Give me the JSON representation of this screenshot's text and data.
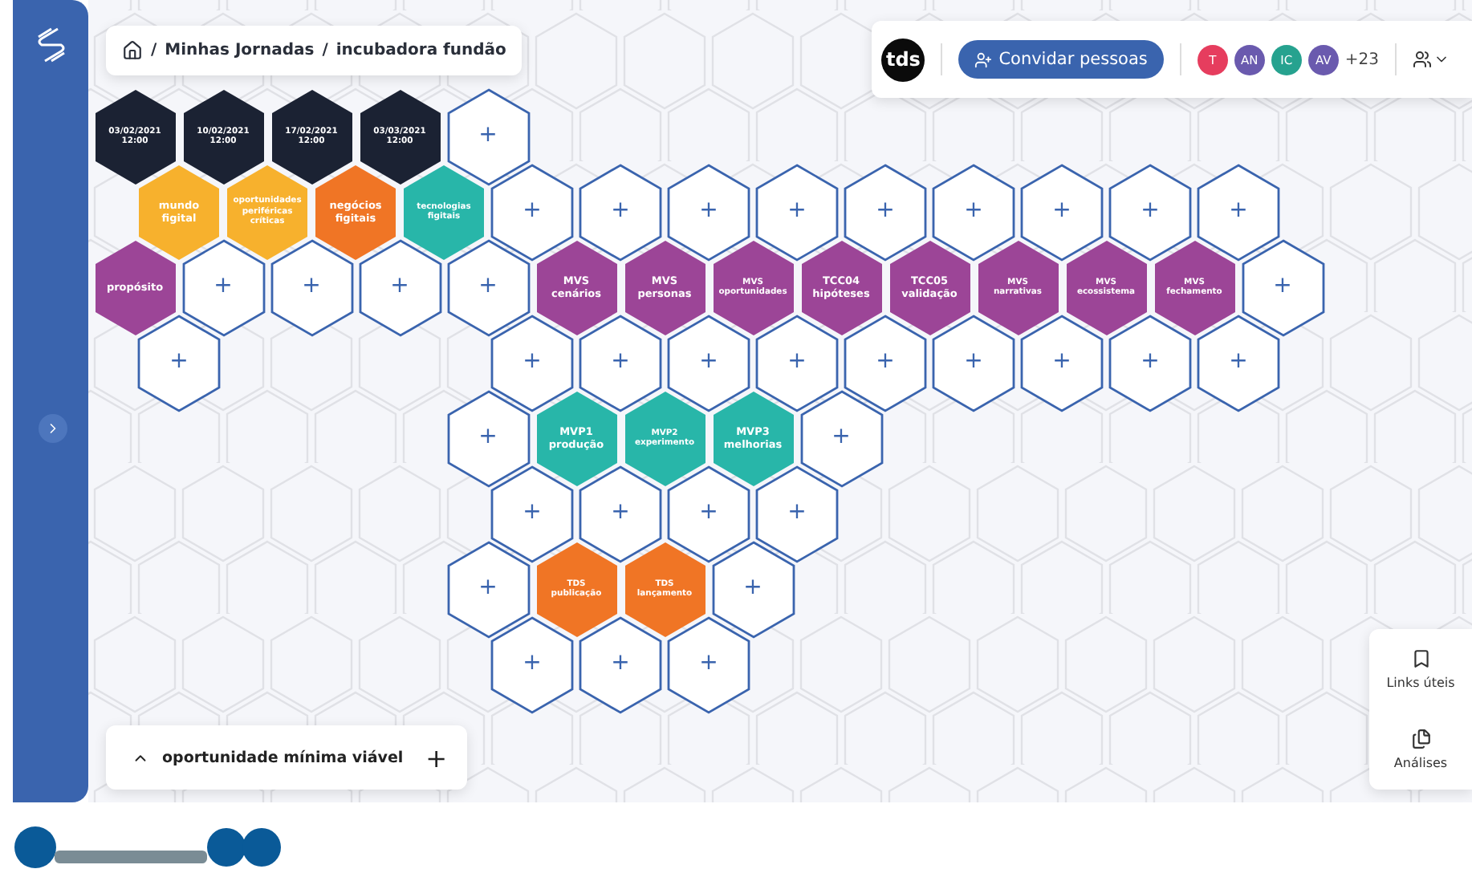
{
  "breadcrumb": {
    "items": [
      "Minhas Jornadas",
      "incubadora fundão"
    ],
    "separator": "/"
  },
  "toolbar": {
    "brand": "tds",
    "invite_button": "Convidar pessoas",
    "members": [
      {
        "initials": "T",
        "color": "#e63d5e"
      },
      {
        "initials": "AN",
        "color": "#6a5aae"
      },
      {
        "initials": "IC",
        "color": "#26a28f"
      },
      {
        "initials": "AV",
        "color": "#6a5aae"
      }
    ],
    "more_members": "+23"
  },
  "grid": {
    "rows": [
      [
        {
          "kind": "date",
          "lines": [
            "03/02/2021",
            "12:00"
          ]
        },
        {
          "kind": "date",
          "lines": [
            "10/02/2021",
            "12:00"
          ]
        },
        {
          "kind": "date",
          "lines": [
            "17/02/2021",
            "12:00"
          ]
        },
        {
          "kind": "date",
          "lines": [
            "03/03/2021",
            "12:00"
          ]
        },
        {
          "kind": "add",
          "lines": [
            "+"
          ]
        }
      ],
      [
        {
          "kind": "topic",
          "color": "#f7b12d",
          "lines": [
            "mundo",
            "figital"
          ]
        },
        {
          "kind": "topic",
          "color": "#f7b12d",
          "lines": [
            "oportunidades",
            "periféricas",
            "críticas"
          ]
        },
        {
          "kind": "topic",
          "color": "#f07525",
          "lines": [
            "negócios",
            "figitais"
          ]
        },
        {
          "kind": "topic",
          "color": "#28b6a9",
          "lines": [
            "tecnologias",
            "figitais"
          ]
        },
        {
          "kind": "add",
          "lines": [
            "+"
          ]
        },
        {
          "kind": "add",
          "lines": [
            "+"
          ]
        },
        {
          "kind": "add",
          "lines": [
            "+"
          ]
        },
        {
          "kind": "add",
          "lines": [
            "+"
          ]
        },
        {
          "kind": "add",
          "lines": [
            "+"
          ]
        },
        {
          "kind": "add",
          "lines": [
            "+"
          ]
        },
        {
          "kind": "add",
          "lines": [
            "+"
          ]
        },
        {
          "kind": "add",
          "lines": [
            "+"
          ]
        },
        {
          "kind": "add",
          "lines": [
            "+"
          ]
        }
      ],
      [
        {
          "kind": "topic",
          "color": "#9c4597",
          "lines": [
            "propósito"
          ]
        },
        {
          "kind": "add",
          "lines": [
            "+"
          ]
        },
        {
          "kind": "add",
          "lines": [
            "+"
          ]
        },
        {
          "kind": "add",
          "lines": [
            "+"
          ]
        },
        {
          "kind": "add",
          "lines": [
            "+"
          ]
        },
        {
          "kind": "topic",
          "color": "#9c4597",
          "lines": [
            "MVS",
            "cenários"
          ]
        },
        {
          "kind": "topic",
          "color": "#9c4597",
          "lines": [
            "MVS",
            "personas"
          ]
        },
        {
          "kind": "topic",
          "color": "#9c4597",
          "lines": [
            "MVS",
            "oportunidades"
          ]
        },
        {
          "kind": "topic",
          "color": "#9c4597",
          "lines": [
            "TCC04",
            "hipóteses"
          ]
        },
        {
          "kind": "topic",
          "color": "#9c4597",
          "lines": [
            "TCC05",
            "validação"
          ]
        },
        {
          "kind": "topic",
          "color": "#9c4597",
          "lines": [
            "MVS",
            "narrativas"
          ]
        },
        {
          "kind": "topic",
          "color": "#9c4597",
          "lines": [
            "MVS",
            "ecossistema"
          ]
        },
        {
          "kind": "topic",
          "color": "#9c4597",
          "lines": [
            "MVS",
            "fechamento"
          ]
        },
        {
          "kind": "add",
          "lines": [
            "+"
          ]
        }
      ],
      [
        {
          "kind": "add",
          "lines": [
            "+"
          ]
        },
        {
          "kind": "empty"
        },
        {
          "kind": "empty"
        },
        {
          "kind": "empty"
        },
        {
          "kind": "add",
          "lines": [
            "+"
          ]
        },
        {
          "kind": "add",
          "lines": [
            "+"
          ]
        },
        {
          "kind": "add",
          "lines": [
            "+"
          ]
        },
        {
          "kind": "add",
          "lines": [
            "+"
          ]
        },
        {
          "kind": "add",
          "lines": [
            "+"
          ]
        },
        {
          "kind": "add",
          "lines": [
            "+"
          ]
        },
        {
          "kind": "add",
          "lines": [
            "+"
          ]
        },
        {
          "kind": "add",
          "lines": [
            "+"
          ]
        },
        {
          "kind": "add",
          "lines": [
            "+"
          ]
        }
      ],
      [
        {
          "kind": "empty"
        },
        {
          "kind": "empty"
        },
        {
          "kind": "empty"
        },
        {
          "kind": "empty"
        },
        {
          "kind": "add",
          "lines": [
            "+"
          ]
        },
        {
          "kind": "topic",
          "color": "#28b6a9",
          "lines": [
            "MVP1",
            "produção"
          ]
        },
        {
          "kind": "topic",
          "color": "#28b6a9",
          "lines": [
            "MVP2",
            "experimento"
          ]
        },
        {
          "kind": "topic",
          "color": "#28b6a9",
          "lines": [
            "MVP3",
            "melhorias"
          ]
        },
        {
          "kind": "add",
          "lines": [
            "+"
          ]
        }
      ],
      [
        {
          "kind": "empty"
        },
        {
          "kind": "empty"
        },
        {
          "kind": "empty"
        },
        {
          "kind": "empty"
        },
        {
          "kind": "add",
          "lines": [
            "+"
          ]
        },
        {
          "kind": "add",
          "lines": [
            "+"
          ]
        },
        {
          "kind": "add",
          "lines": [
            "+"
          ]
        },
        {
          "kind": "add",
          "lines": [
            "+"
          ]
        }
      ],
      [
        {
          "kind": "empty"
        },
        {
          "kind": "empty"
        },
        {
          "kind": "empty"
        },
        {
          "kind": "empty"
        },
        {
          "kind": "add",
          "lines": [
            "+"
          ]
        },
        {
          "kind": "topic",
          "color": "#f07525",
          "lines": [
            "TDS",
            "publicação"
          ]
        },
        {
          "kind": "topic",
          "color": "#f07525",
          "lines": [
            "TDS",
            "lançamento"
          ]
        },
        {
          "kind": "add",
          "lines": [
            "+"
          ]
        }
      ],
      [
        {
          "kind": "empty"
        },
        {
          "kind": "empty"
        },
        {
          "kind": "empty"
        },
        {
          "kind": "empty"
        },
        {
          "kind": "add",
          "lines": [
            "+"
          ]
        },
        {
          "kind": "add",
          "lines": [
            "+"
          ]
        },
        {
          "kind": "add",
          "lines": [
            "+"
          ]
        }
      ]
    ]
  },
  "journey_panel": {
    "title": "oportunidade mínima viável",
    "expand_symbol": "+"
  },
  "side_panel": {
    "items": [
      {
        "kind": "bookmark",
        "label": "Links úteis"
      },
      {
        "kind": "copy",
        "label": "Análises"
      }
    ]
  }
}
